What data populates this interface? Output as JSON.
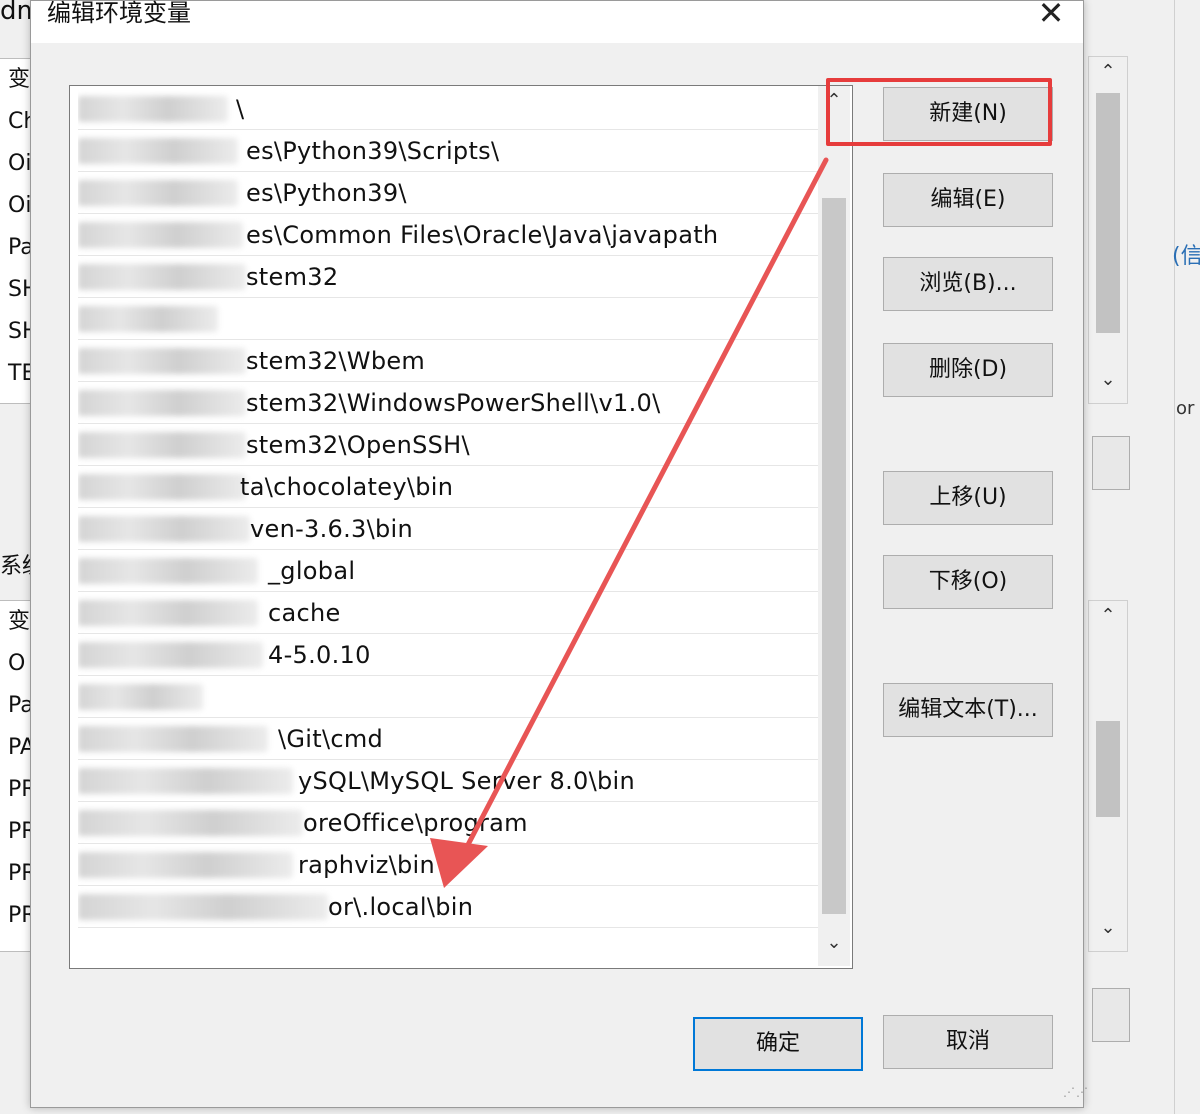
{
  "background": {
    "title_fragment": "dm",
    "user_vars_rows": [
      "变",
      "Ch",
      "Oi",
      "Oi",
      "Pa",
      "SH",
      "SH",
      "TE"
    ],
    "system_label": "系统",
    "system_vars_rows": [
      "变",
      "O",
      "Pa",
      "PA",
      "PR",
      "PR",
      "PR",
      "PR"
    ],
    "right_fragment_1": "(信",
    "right_fragment_2": "or"
  },
  "dialog": {
    "title": "编辑环境变量",
    "close_glyph": "✕",
    "path_entries": [
      {
        "visible": "\\"
      },
      {
        "visible": "es\\Python39\\Scripts\\"
      },
      {
        "visible": "es\\Python39\\"
      },
      {
        "visible": "es\\Common Files\\Oracle\\Java\\javapath"
      },
      {
        "visible": "stem32"
      },
      {
        "visible": ""
      },
      {
        "visible": "stem32\\Wbem"
      },
      {
        "visible": "stem32\\WindowsPowerShell\\v1.0\\"
      },
      {
        "visible": "stem32\\OpenSSH\\"
      },
      {
        "visible": "ta\\chocolatey\\bin"
      },
      {
        "visible": "ven-3.6.3\\bin"
      },
      {
        "visible": "_global"
      },
      {
        "visible": "cache"
      },
      {
        "visible": "4-5.0.10"
      },
      {
        "visible": ""
      },
      {
        "visible": "\\Git\\cmd"
      },
      {
        "visible": "ySQL\\MySQL Server 8.0\\bin"
      },
      {
        "visible": "oreOffice\\program"
      },
      {
        "visible": "raphviz\\bin"
      },
      {
        "visible": "or\\.local\\bin"
      }
    ],
    "buttons": {
      "new": "新建(N)",
      "edit": "编辑(E)",
      "browse": "浏览(B)...",
      "delete": "删除(D)",
      "move_up": "上移(U)",
      "move_down": "下移(O)",
      "edit_text": "编辑文本(T)...",
      "ok": "确定",
      "cancel": "取消"
    },
    "scroll_up_glyph": "⌃",
    "scroll_down_glyph": "⌄"
  },
  "annotation": {
    "highlight_color": "#e63c3c",
    "arrow_color": "#e85555"
  }
}
